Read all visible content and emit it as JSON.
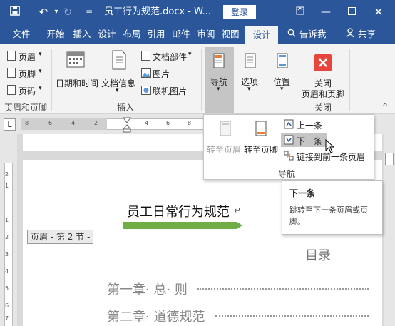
{
  "titlebar": {
    "doc_title": "员工行为规范.docx - W...",
    "login": "登录",
    "save_icon": "save-icon",
    "undo_icon": "undo-icon",
    "redo_icon": "redo-icon"
  },
  "tabs": [
    "文件",
    "开始",
    "插入",
    "设计",
    "布局",
    "引用",
    "邮件",
    "审阅",
    "视图",
    "设计"
  ],
  "tell_me": "告诉我",
  "share": "共享",
  "ribbon": {
    "header_label": "页眉",
    "footer_label": "页脚",
    "page_number_label": "页码",
    "group_header_footer": "页眉和页脚",
    "date_time": "日期和时间",
    "doc_info": "文档信息",
    "doc_parts": "文档部件",
    "picture": "图片",
    "online_picture": "联机图片",
    "group_insert": "插入",
    "navigation": "导航",
    "options": "选项",
    "position": "位置",
    "close_line1": "关闭",
    "close_line2": "页眉和页脚",
    "group_close": "关闭"
  },
  "ruler": {
    "left_mark": "L",
    "ticks": [
      "8",
      "6",
      "4",
      "2",
      "2",
      "4",
      "6",
      "8"
    ]
  },
  "nav_dropdown": {
    "goto_header": "转至页眉",
    "goto_footer": "转至页脚",
    "previous": "上一条",
    "next": "下一条",
    "link_previous": "链接到前一条页眉",
    "group": "导航"
  },
  "tooltip": {
    "title": "下一条",
    "desc_line1": "跳转至下一条页眉或页",
    "desc_line2": "脚。"
  },
  "document": {
    "header_text": "员工日常行为规范",
    "header_tag": "页眉 - 第 2 节 -",
    "toc_title": "目录",
    "toc_lines": [
      "第一章· 总· 则",
      "第二章· 道德规范"
    ],
    "accent": "#70ad47"
  },
  "left_ruler_ticks": [
    "2",
    "1",
    "1",
    "2",
    "3",
    "4",
    "5",
    "6",
    "7"
  ]
}
